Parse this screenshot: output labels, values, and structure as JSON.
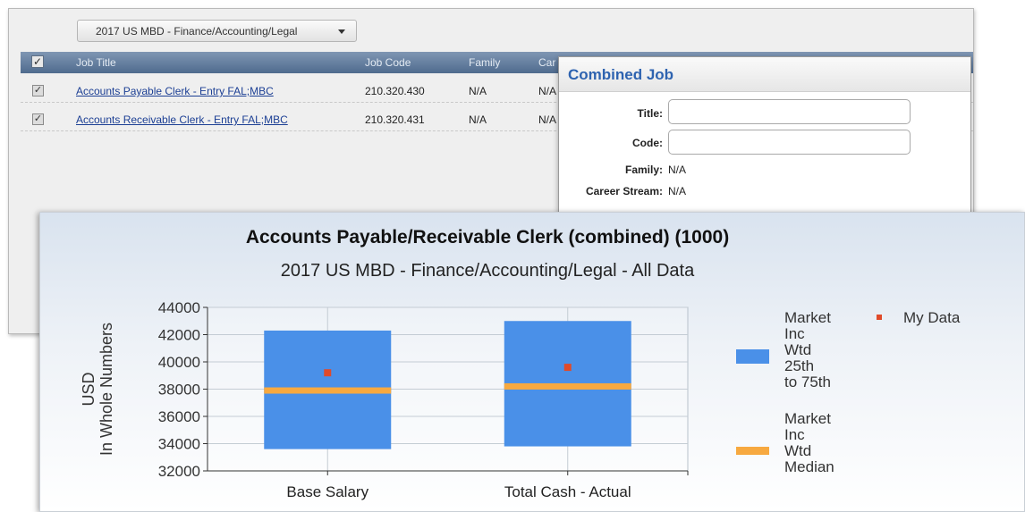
{
  "grid": {
    "dataset": "2017 US MBD - Finance/Accounting/Legal",
    "header_check": "✓",
    "columns": [
      "Job Title",
      "Job Code",
      "Family",
      "Car"
    ],
    "rows": [
      {
        "check": "✓",
        "title": "Accounts Payable Clerk - Entry FAL;MBC",
        "code": "210.320.430",
        "family": "N/A",
        "career": "N/A"
      },
      {
        "check": "✓",
        "title": "Accounts Receivable Clerk - Entry FAL;MBC",
        "code": "210.320.431",
        "family": "N/A",
        "career": "N/A"
      }
    ]
  },
  "panel": {
    "title": "Combined Job",
    "title_label": "Title:",
    "code_label": "Code:",
    "family_label": "Family:",
    "family_value": "N/A",
    "career_label": "Career Stream:",
    "career_value": "N/A",
    "title_value": "",
    "code_value": ""
  },
  "chart_data": {
    "type": "boxplot",
    "title": "Accounts Payable/Receivable Clerk (combined) (1000)",
    "subtitle": "2017 US MBD - Finance/Accounting/Legal - All Data",
    "ylabel": [
      "USD",
      "In Whole Numbers"
    ],
    "ylim": [
      32000,
      44000
    ],
    "yticks": [
      32000,
      34000,
      36000,
      38000,
      40000,
      42000,
      44000
    ],
    "categories": [
      "Base Salary",
      "Total Cash - Actual"
    ],
    "series": [
      {
        "name": "Market Inc Wtd 25th to 75th",
        "color": "#4a90e8",
        "kind": "range",
        "low": [
          33600,
          33800
        ],
        "high": [
          42300,
          43000
        ]
      },
      {
        "name": "Market Inc Wtd Median",
        "color": "#f7a940",
        "kind": "median",
        "values": [
          37900,
          38200
        ]
      },
      {
        "name": "My Data",
        "color": "#e04a2a",
        "kind": "point",
        "values": [
          39200,
          39600
        ]
      }
    ],
    "grid": true,
    "legend": "right"
  },
  "legend": {
    "range_lines": [
      "Market",
      "Inc",
      "Wtd",
      "25th",
      "to 75th"
    ],
    "median_lines": [
      "Market",
      "Inc",
      "Wtd",
      "Median"
    ],
    "mydata": "My Data"
  }
}
